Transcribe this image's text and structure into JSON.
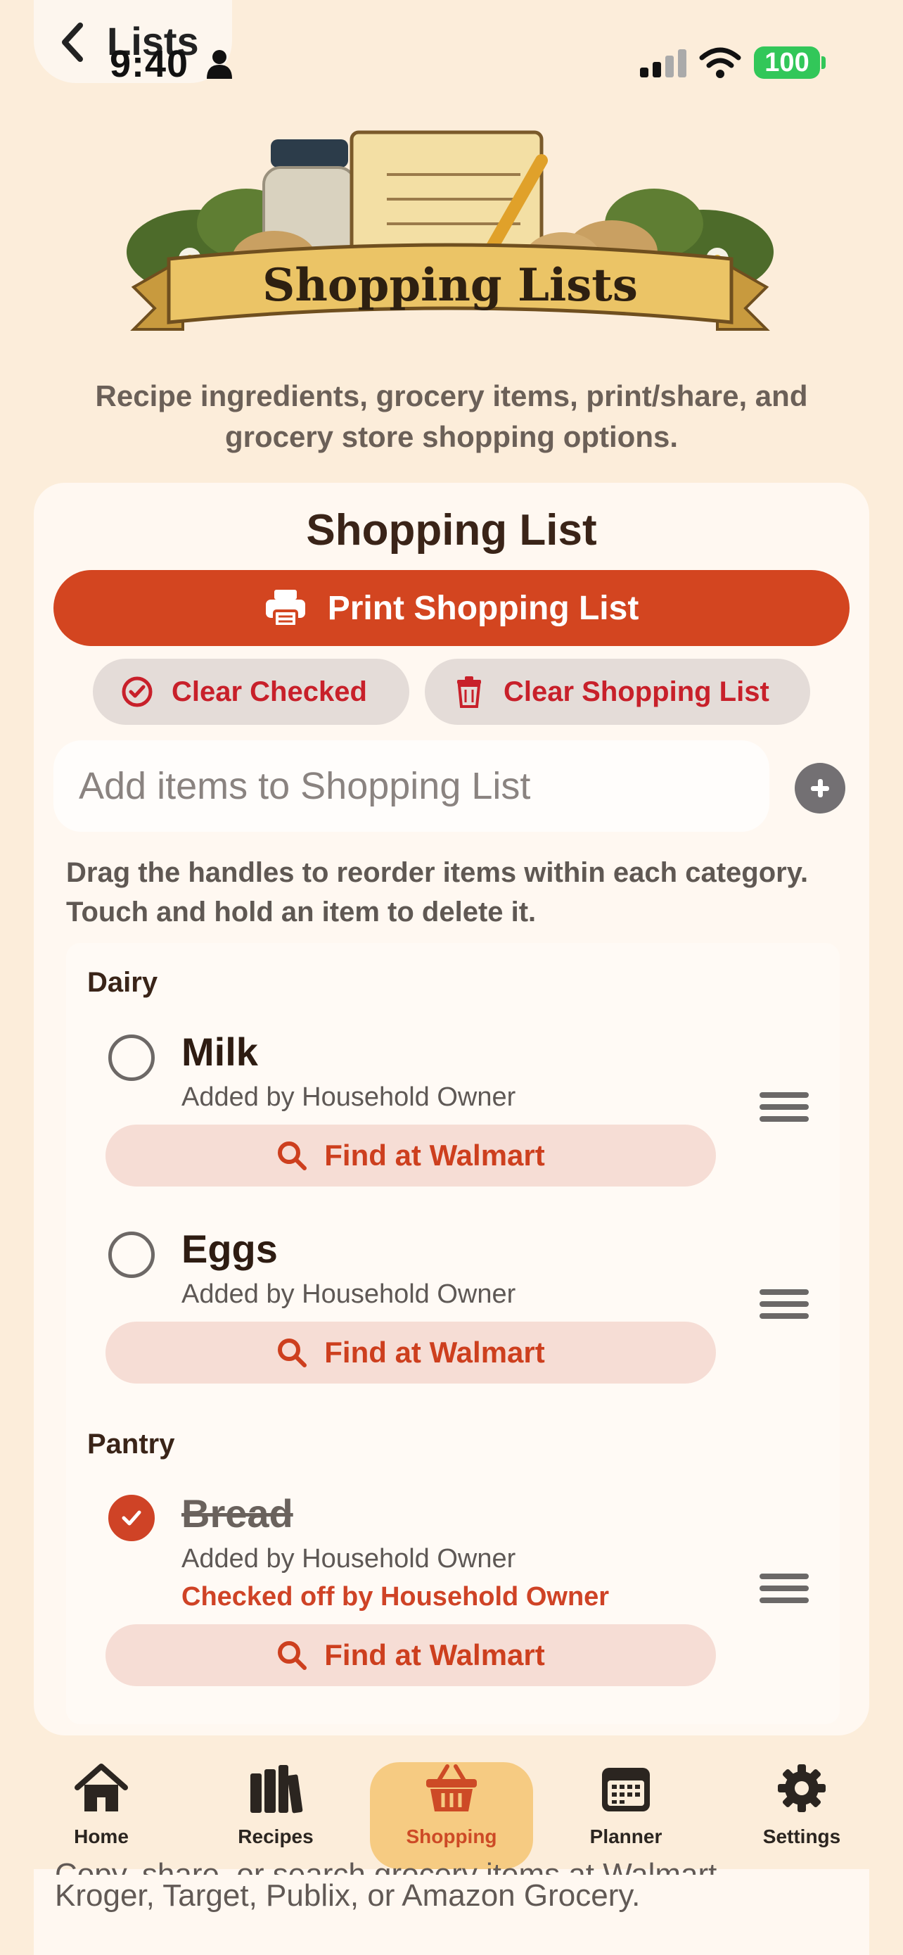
{
  "status_bar": {
    "back_label": "Lists",
    "time": "9:40",
    "battery": "100"
  },
  "banner": {
    "title": "Shopping Lists"
  },
  "subtitle": "Recipe ingredients, grocery items, print/share, and grocery store shopping options.",
  "card": {
    "title": "Shopping List",
    "print_label": "Print Shopping List",
    "clear_checked_label": "Clear Checked",
    "clear_list_label": "Clear Shopping List",
    "add_placeholder": "Add items to Shopping List",
    "helper_text": "Drag the handles to reorder items within each category. Touch and hold an item to delete it."
  },
  "categories": [
    {
      "name": "Dairy",
      "items": [
        {
          "name": "Milk",
          "added_by": "Added by Household Owner",
          "checked": false,
          "find_label": "Find at Walmart"
        },
        {
          "name": "Eggs",
          "added_by": "Added by Household Owner",
          "checked": false,
          "find_label": "Find at Walmart"
        }
      ]
    },
    {
      "name": "Pantry",
      "items": [
        {
          "name": "Bread",
          "added_by": "Added by Household Owner",
          "checked": true,
          "checked_by": "Checked off by Household Owner",
          "find_label": "Find at Walmart"
        }
      ]
    }
  ],
  "tabbar": {
    "tabs": [
      {
        "label": "Home",
        "icon": "home-icon"
      },
      {
        "label": "Recipes",
        "icon": "books-icon"
      },
      {
        "label": "Shopping",
        "icon": "basket-icon",
        "active": true
      },
      {
        "label": "Planner",
        "icon": "calendar-icon"
      },
      {
        "label": "Settings",
        "icon": "gear-icon"
      }
    ]
  },
  "footer": {
    "line1": "Copy, share, or search grocery items at Walmart,",
    "line2": "Kroger, Target, Publix, or Amazon Grocery."
  },
  "colors": {
    "background": "#fcedda",
    "accent": "#d34520",
    "danger": "#c8202a",
    "active_tab": "#f6cb82"
  }
}
